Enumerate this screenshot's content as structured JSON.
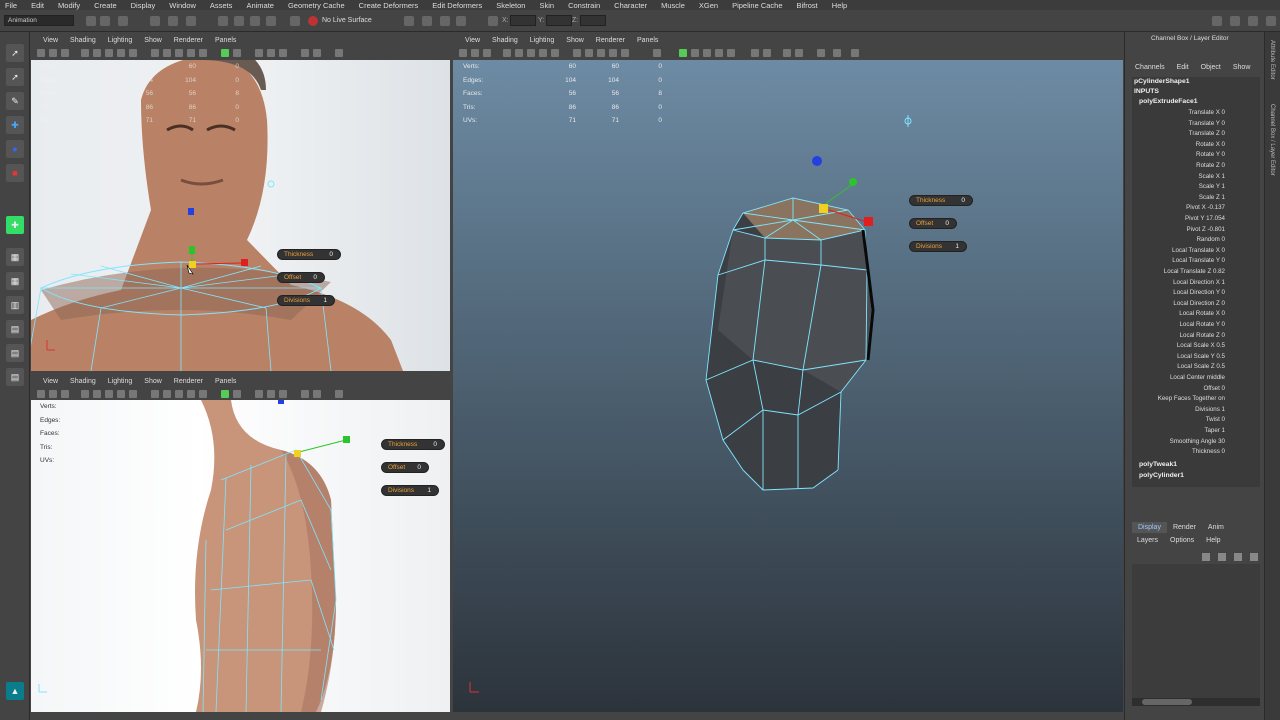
{
  "menubar": [
    "File",
    "Edit",
    "Modify",
    "Create",
    "Display",
    "Window",
    "Assets",
    "Animate",
    "Geometry Cache",
    "Create Deformers",
    "Edit Deformers",
    "Skeleton",
    "Skin",
    "Constrain",
    "Character",
    "Muscle",
    "XGen",
    "Pipeline Cache",
    "Bifrost",
    "Help"
  ],
  "shelf": {
    "mode": "Animation",
    "live_surface": "No Live Surface",
    "x_label": "X:",
    "y_label": "Y:",
    "z_label": "Z:"
  },
  "viewport_menu": [
    "View",
    "Shading",
    "Lighting",
    "Show",
    "Renderer",
    "Panels"
  ],
  "hud_labels": [
    "Verts:",
    "Edges:",
    "Faces:",
    "Tris:",
    "UVs:"
  ],
  "hud_persp": [
    [
      "60",
      "60",
      "0"
    ],
    [
      "104",
      "104",
      "0"
    ],
    [
      "56",
      "56",
      "8"
    ],
    [
      "86",
      "86",
      "0"
    ],
    [
      "71",
      "71",
      "0"
    ]
  ],
  "hud_top": [
    [
      "60",
      "60",
      "0"
    ],
    [
      "104",
      "104",
      "0"
    ],
    [
      "56",
      "56",
      "8"
    ],
    [
      "86",
      "86",
      "0"
    ],
    [
      "71",
      "71",
      "0"
    ]
  ],
  "manipulators": {
    "persp": [
      [
        "Thickness",
        "0"
      ],
      [
        "Offset",
        "0"
      ],
      [
        "Divisions",
        "1"
      ]
    ],
    "top": [
      [
        "Thickness",
        "0"
      ],
      [
        "Offset",
        "0"
      ],
      [
        "Divisions",
        "1"
      ]
    ],
    "side": [
      [
        "Thickness",
        "0"
      ],
      [
        "Offset",
        "0"
      ],
      [
        "Divisions",
        "1"
      ]
    ]
  },
  "channel_box": {
    "title": "Channel Box / Layer Editor",
    "menu": [
      "Channels",
      "Edit",
      "Object",
      "Show"
    ],
    "shape": "pCylinderShape1",
    "inputs": "INPUTS",
    "node": "polyExtrudeFace1",
    "attributes": [
      "Translate X 0",
      "Translate Y 0",
      "Translate Z 0",
      "Rotate X 0",
      "Rotate Y 0",
      "Rotate Z 0",
      "Scale X 1",
      "Scale Y 1",
      "Scale Z 1",
      "Pivot X -0.137",
      "Pivot Y 17.054",
      "Pivot Z -0.801",
      "Random 0",
      "Local Translate X 0",
      "Local Translate Y 0",
      "Local Translate Z 0.82",
      "Local Direction X 1",
      "Local Direction Y 0",
      "Local Direction Z 0",
      "Local Rotate X 0",
      "Local Rotate Y 0",
      "Local Rotate Z 0",
      "Local Scale X 0.5",
      "Local Scale Y 0.5",
      "Local Scale Z 0.5",
      "Local Center middle",
      "Offset 0",
      "Keep Faces Together on",
      "Divisions 1",
      "Twist 0",
      "Taper 1",
      "Smoothing Angle 30",
      "Thickness 0"
    ],
    "other_nodes": [
      "polyTweak1",
      "polyCylinder1"
    ]
  },
  "layer_editor": {
    "tabs": [
      "Display",
      "Render",
      "Anim"
    ],
    "menu": [
      "Layers",
      "Options",
      "Help"
    ]
  },
  "side_tabs": [
    "Attribute Editor",
    "Channel Box / Layer Editor"
  ],
  "colors": {
    "manip_label": "#e9a13a",
    "wire": "#7fe6ff",
    "channel_link": "#9ec9ff"
  }
}
